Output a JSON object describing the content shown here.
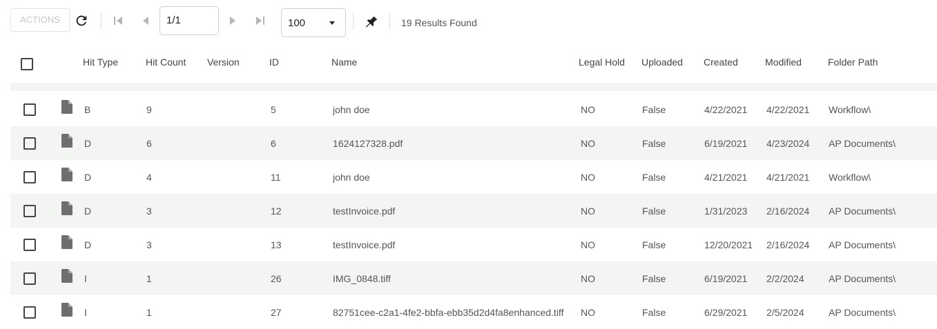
{
  "toolbar": {
    "actions_label": "ACTIONS",
    "page_value": "1/1",
    "page_size": "100",
    "results_text": "19 Results Found"
  },
  "columns": [
    "Hit Type",
    "Hit Count",
    "Version",
    "ID",
    "Name",
    "Legal Hold",
    "Uploaded",
    "Created",
    "Modified",
    "Folder Path"
  ],
  "rows": [
    {
      "hit_type": "B",
      "hit_count": "9",
      "version": "",
      "id": "5",
      "name": "john doe",
      "legal_hold": "NO",
      "uploaded": "False",
      "created": "4/22/2021",
      "modified": "4/22/2021",
      "folder_path": "Workflow\\"
    },
    {
      "hit_type": "D",
      "hit_count": "6",
      "version": "",
      "id": "6",
      "name": "1624127328.pdf",
      "legal_hold": "NO",
      "uploaded": "False",
      "created": "6/19/2021",
      "modified": "4/23/2024",
      "folder_path": "AP Documents\\"
    },
    {
      "hit_type": "D",
      "hit_count": "4",
      "version": "",
      "id": "11",
      "name": "john doe",
      "legal_hold": "NO",
      "uploaded": "False",
      "created": "4/21/2021",
      "modified": "4/21/2021",
      "folder_path": "Workflow\\"
    },
    {
      "hit_type": "D",
      "hit_count": "3",
      "version": "",
      "id": "12",
      "name": "testInvoice.pdf",
      "legal_hold": "NO",
      "uploaded": "False",
      "created": "1/31/2023",
      "modified": "2/16/2024",
      "folder_path": "AP Documents\\"
    },
    {
      "hit_type": "D",
      "hit_count": "3",
      "version": "",
      "id": "13",
      "name": "testInvoice.pdf",
      "legal_hold": "NO",
      "uploaded": "False",
      "created": "12/20/2021",
      "modified": "2/16/2024",
      "folder_path": "AP Documents\\"
    },
    {
      "hit_type": "I",
      "hit_count": "1",
      "version": "",
      "id": "26",
      "name": "IMG_0848.tiff",
      "legal_hold": "NO",
      "uploaded": "False",
      "created": "6/19/2021",
      "modified": "2/2/2024",
      "folder_path": "AP Documents\\"
    },
    {
      "hit_type": "I",
      "hit_count": "1",
      "version": "",
      "id": "27",
      "name": "82751cee-c2a1-4fe2-bbfa-ebb35d2d4fa8enhanced.tiff",
      "legal_hold": "NO",
      "uploaded": "False",
      "created": "6/29/2021",
      "modified": "2/5/2024",
      "folder_path": "AP Documents\\"
    }
  ]
}
